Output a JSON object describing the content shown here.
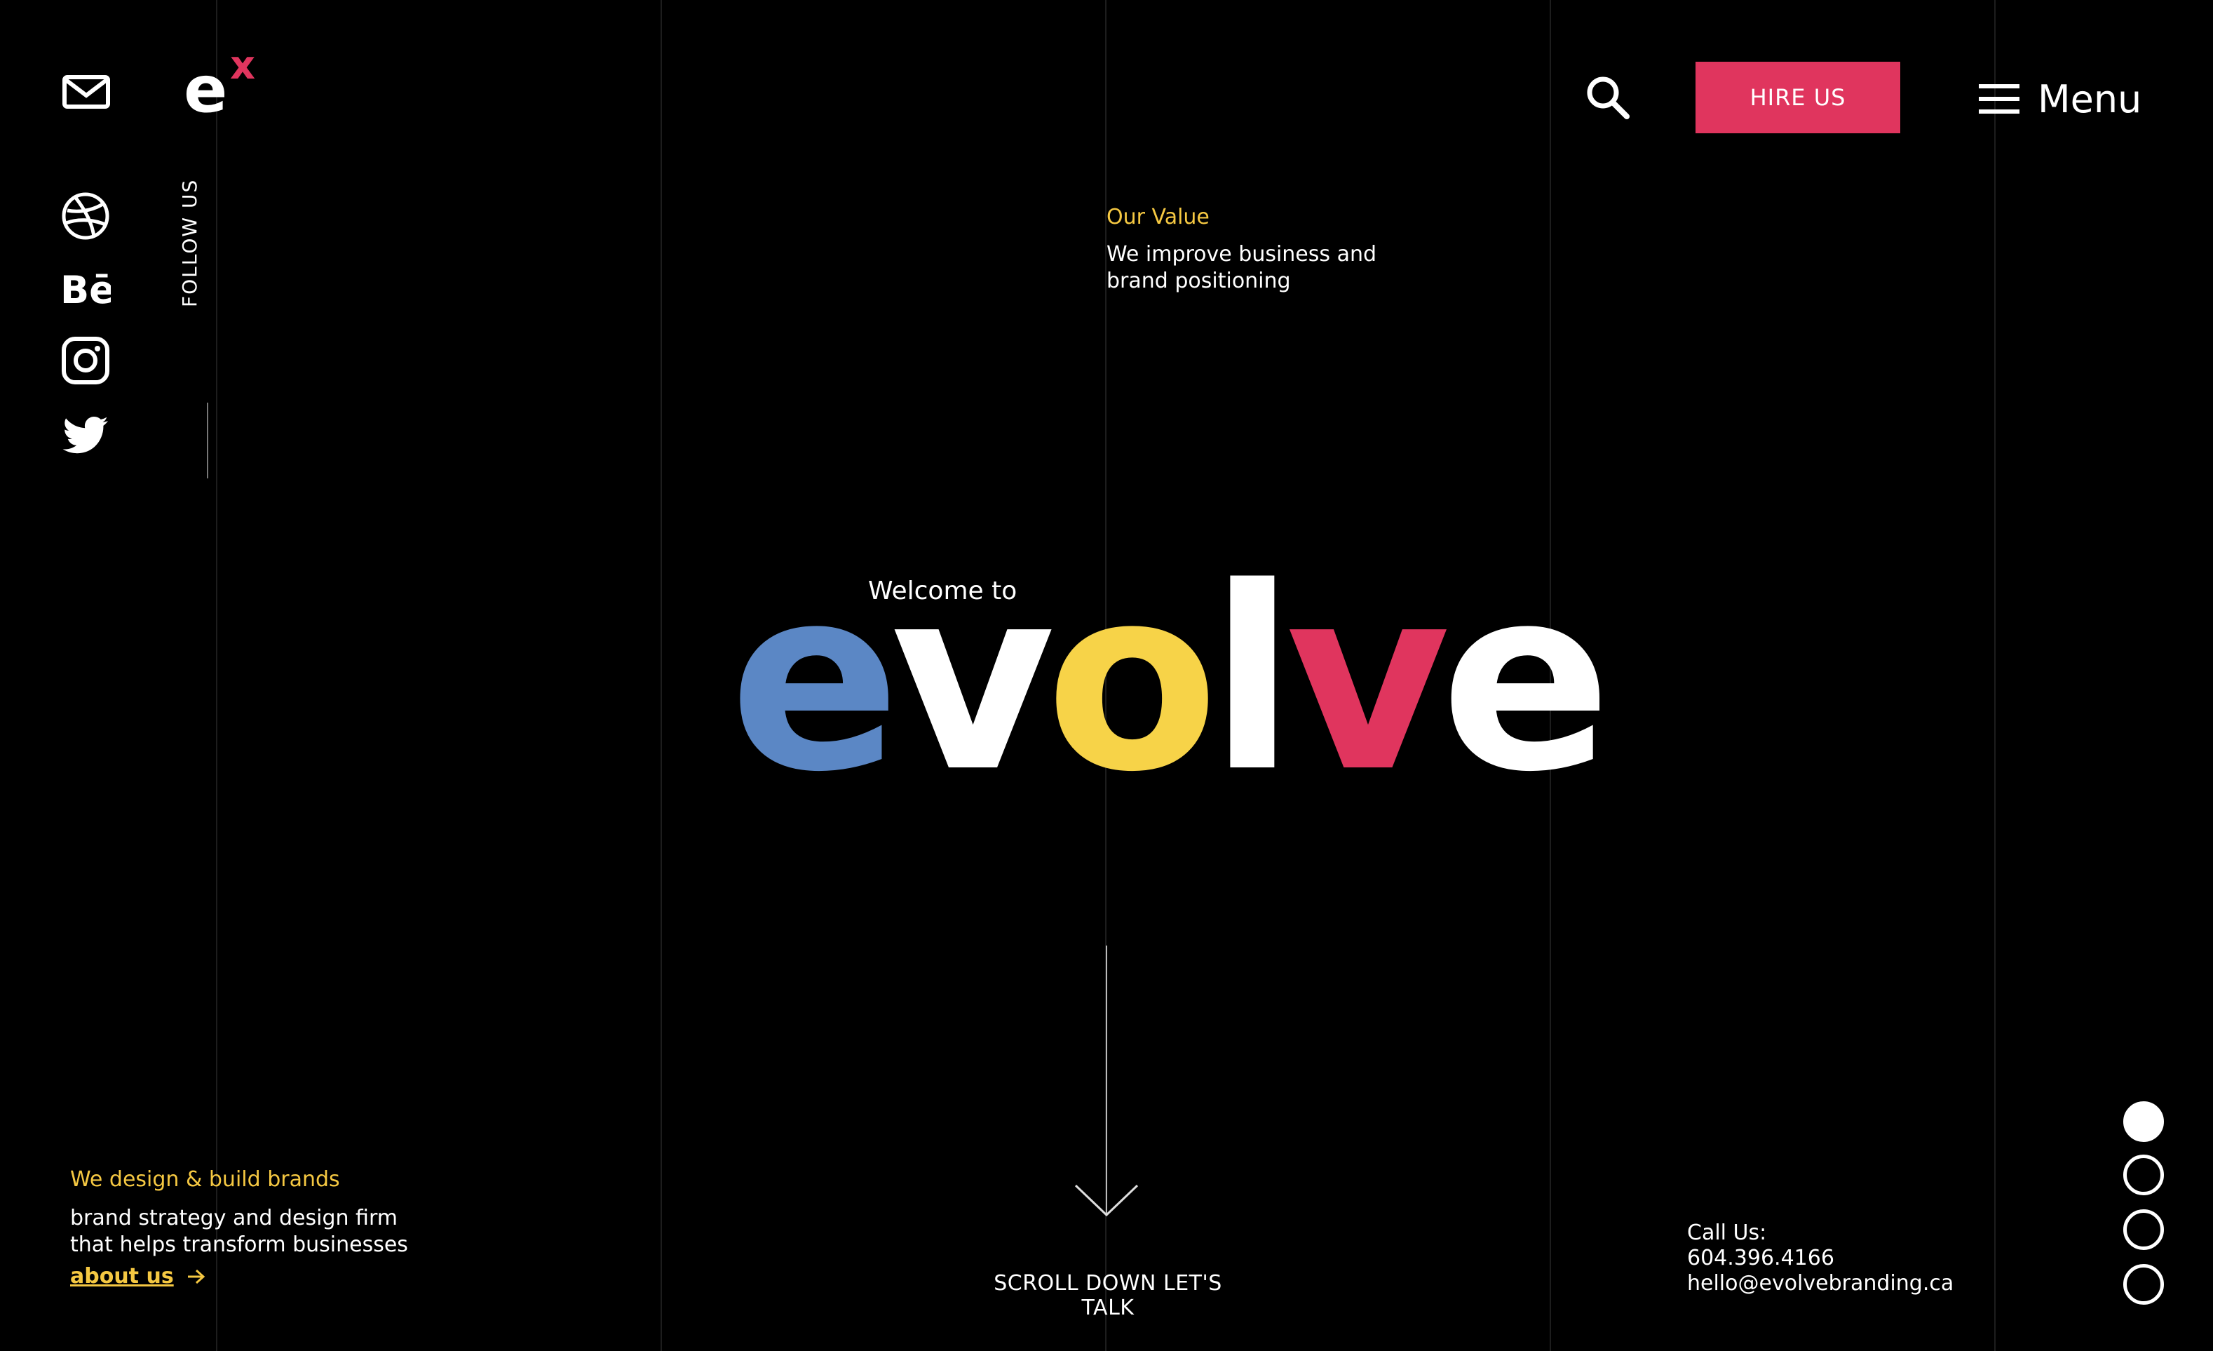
{
  "brand": {
    "logo_letter": "e",
    "logo_super": "x"
  },
  "social": {
    "follow_label": "FOLLOW US",
    "icons": [
      "dribbble-icon",
      "behance-icon",
      "instagram-icon",
      "twitter-icon"
    ]
  },
  "header": {
    "hire_label": "HIRE US",
    "menu_label": "Menu"
  },
  "value": {
    "title": "Our Value",
    "text": "We improve business and brand positioning"
  },
  "hero": {
    "welcome": "Welcome to",
    "letters": [
      {
        "char": "e",
        "color": "#5b87c5"
      },
      {
        "char": "v",
        "color": "#ffffff"
      },
      {
        "char": "o",
        "color": "#f7d348"
      },
      {
        "char": "l",
        "color": "#ffffff"
      },
      {
        "char": "v",
        "color": "#e0355e"
      },
      {
        "char": "e",
        "color": "#ffffff"
      }
    ]
  },
  "scroll": {
    "label": "SCROLL DOWN LET'S TALK"
  },
  "about": {
    "title": "We design & build brands",
    "text_line1": "brand strategy and design firm",
    "text_line2": "that helps transform businesses",
    "link": "about us"
  },
  "contact": {
    "label": "Call Us:",
    "phone": "604.396.4166",
    "email": "hello@evolvebranding.ca"
  },
  "pagination": {
    "total": 4,
    "active": 1
  },
  "colors": {
    "accent_pink": "#e0355e",
    "accent_yellow": "#f5c842",
    "accent_blue": "#5b87c5",
    "background": "#000000"
  }
}
